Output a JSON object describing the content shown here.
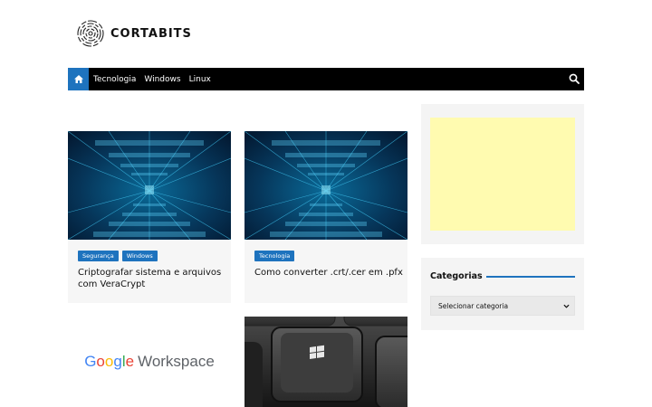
{
  "brand": {
    "name": "CORTABITS",
    "logo_icon": "fingerprint-icon"
  },
  "nav": {
    "home_icon": "home-icon",
    "items": [
      "Tecnologia",
      "Windows",
      "Linux"
    ],
    "search_icon": "search-icon",
    "accent": "#1e73be"
  },
  "posts": [
    {
      "tags": [
        "Segurança",
        "Windows"
      ],
      "title": "Criptografar sistema e arquivos com VeraCrypt"
    },
    {
      "tags": [
        "Tecnologia"
      ],
      "title": "Como converter .crt/.cer em .pfx"
    }
  ],
  "promo": {
    "google": [
      "G",
      "o",
      "o",
      "g",
      "l",
      "e"
    ],
    "product": "Workspace"
  },
  "sidebar": {
    "ad_color": "#fffbb0",
    "categories": {
      "title": "Categorias",
      "select_value": "Selecionar categoria"
    }
  }
}
